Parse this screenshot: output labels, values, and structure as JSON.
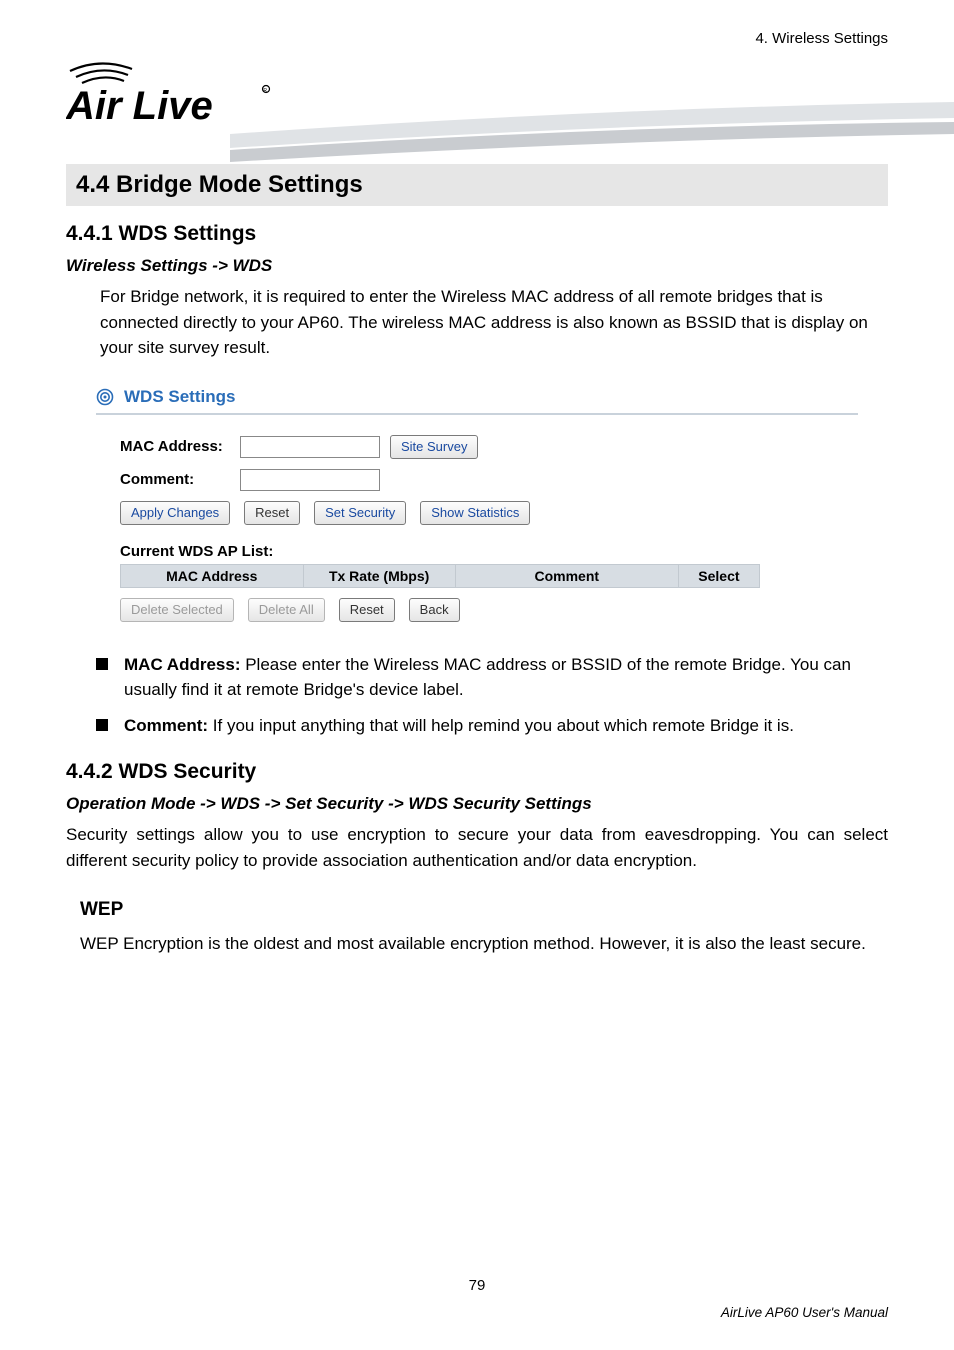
{
  "header": {
    "chapter": "4. Wireless Settings",
    "logo_text": "Air Live"
  },
  "section": {
    "h1": "4.4 Bridge Mode Settings",
    "h2_1": "4.4.1 WDS Settings",
    "crumb_1": "Wireless Settings -> WDS",
    "intro_1": "For Bridge network, it is required to enter the Wireless MAC address of all remote bridges that is connected directly to your AP60.    The wireless MAC address is also known as BSSID that is display on your site survey result."
  },
  "panel": {
    "title": "WDS Settings",
    "mac_label": "MAC Address:",
    "comment_label": "Comment:",
    "site_survey": "Site Survey",
    "apply": "Apply Changes",
    "reset": "Reset",
    "set_security": "Set Security",
    "show_stats": "Show Statistics",
    "list_title": "Current WDS AP List:",
    "cols": {
      "mac": "MAC Address",
      "tx": "Tx Rate (Mbps)",
      "comment": "Comment",
      "select": "Select"
    },
    "delete_selected": "Delete Selected",
    "delete_all": "Delete All",
    "reset2": "Reset",
    "back": "Back"
  },
  "bullets": {
    "b1_label": "MAC Address:",
    "b1_text": "   Please enter the Wireless MAC address or BSSID of the remote Bridge.    You can usually find it at remote Bridge's device label.",
    "b2_label": "Comment:",
    "b2_text": "   If you input anything that will help remind you about which remote Bridge it is."
  },
  "security": {
    "h2": "4.4.2 WDS Security",
    "crumb": "Operation Mode -> WDS -> Set Security -> WDS Security Settings",
    "body": "Security settings allow you to use encryption to secure your data from eavesdropping. You can select different security policy to provide association authentication and/or data encryption.",
    "wep_h": "WEP",
    "wep_body": "WEP Encryption is the oldest and most available encryption method.    However, it is also the least secure."
  },
  "footer": {
    "pagenum": "79",
    "manual": "AirLive AP60 User's Manual"
  }
}
